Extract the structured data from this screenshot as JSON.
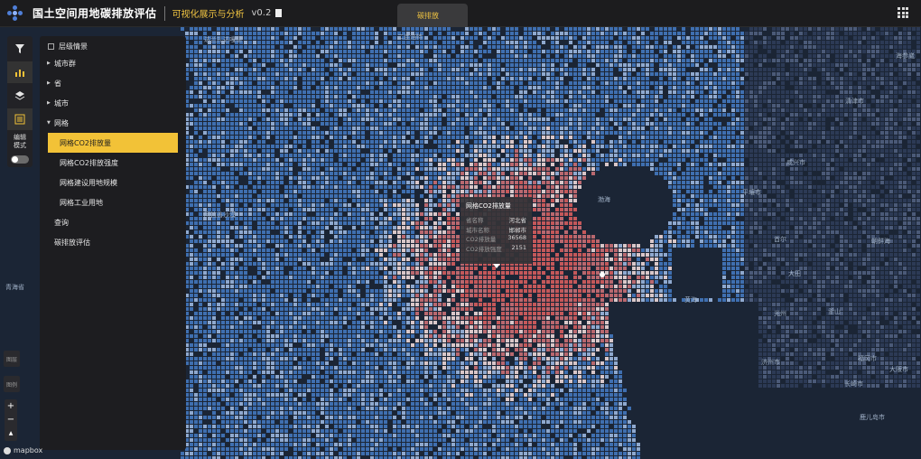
{
  "header": {
    "app_title": "国土空间用地碳排放评估",
    "subtitle": "可视化展示与分析",
    "version": "v0.2",
    "active_tab": "碳排放"
  },
  "toolbar": {
    "tools": [
      "filter-icon",
      "chart-icon",
      "layers-icon",
      "list-icon"
    ],
    "edit_mode_label_1": "编辑",
    "edit_mode_label_2": "模式",
    "edit_mode_on": false
  },
  "panel": {
    "header": "层级情景",
    "items": [
      {
        "label": "城市群",
        "expanded": false
      },
      {
        "label": "省",
        "expanded": false
      },
      {
        "label": "城市",
        "expanded": false
      },
      {
        "label": "网格",
        "expanded": true
      }
    ],
    "grid_children": [
      "网格CO2排放量",
      "网格CO2排放强度",
      "网格建设用地规模",
      "网格工业用地"
    ],
    "selected": "网格CO2排放量",
    "extra": [
      "查询",
      "碳排放评估"
    ]
  },
  "map_labels": {
    "label_1": "达兰扎达嘎德",
    "label_2": "二连浩特",
    "label_3": "海参崴",
    "label_4": "清津市",
    "label_5": "咸兴市",
    "label_6": "平壤市",
    "label_7": "渤海",
    "label_8": "黄海",
    "label_9": "首尔",
    "label_10": "大田",
    "label_11": "光州",
    "label_12": "釜山",
    "label_13": "济州市",
    "label_14": "青海省",
    "label_15": "阿拉善沙漠",
    "label_16": "朝鲜海",
    "label_17": "大阪市",
    "label_18": "福冈市",
    "label_19": "长崎市",
    "label_20": "鹿儿岛市"
  },
  "tooltip": {
    "title": "网格CO2排放量",
    "rows": [
      {
        "key": "省名称",
        "value": "河北省"
      },
      {
        "key": "城市名称",
        "value": "邯郸市"
      },
      {
        "key": "CO2排放量",
        "value": "36568"
      },
      {
        "key": "CO2排放强度",
        "value": "2151"
      }
    ]
  },
  "map_controls": {
    "zoom_in": "+",
    "zoom_out": "−",
    "compass": "▲",
    "attribution": "mapbox",
    "side_btn_1": "图层",
    "side_btn_2": "图例"
  },
  "colors": {
    "selected": "#f2c237",
    "high": "#c4585a",
    "mid": "#d9c7c9",
    "low": "#3f6fb0"
  }
}
